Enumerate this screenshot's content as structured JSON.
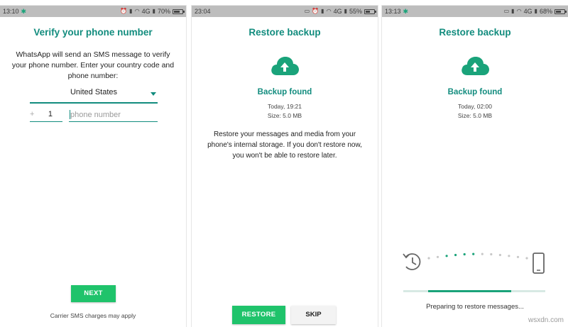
{
  "colors": {
    "accent": "#128c7e",
    "button_green": "#1fc36b",
    "statusbar": "#bdbdbd",
    "progress": "#1aa37a"
  },
  "screens": [
    {
      "statusbar": {
        "time": "13:10",
        "network": "4G",
        "battery": "70%",
        "battery_level": 0.7
      },
      "title": "Verify your phone number",
      "description": "WhatsApp will send an SMS message to verify your phone number. Enter your country code and phone number:",
      "country_select": {
        "value": "United States",
        "icon": "chevron-down-icon"
      },
      "country_code": {
        "prefix": "+",
        "value": "1"
      },
      "phone_input": {
        "placeholder": "phone number",
        "value": ""
      },
      "next_button": "NEXT",
      "carrier_note": "Carrier SMS charges may apply"
    },
    {
      "statusbar": {
        "time": "23:04",
        "network": "4G",
        "battery": "55%",
        "battery_level": 0.55
      },
      "title": "Restore backup",
      "cloud_icon": "cloud-upload-icon",
      "backup_found": "Backup found",
      "backup_date": "Today, 19:21",
      "backup_size": "Size: 5.0 MB",
      "description": "Restore your messages and media from your phone's internal storage. If you don't restore now, you won't be able to restore later.",
      "restore_button": "RESTORE",
      "skip_button": "SKIP"
    },
    {
      "statusbar": {
        "time": "13:13",
        "network": "4G",
        "battery": "68%",
        "battery_level": 0.68
      },
      "title": "Restore backup",
      "cloud_icon": "cloud-upload-icon",
      "backup_found": "Backup found",
      "backup_date": "Today, 02:00",
      "backup_size": "Size: 5.0 MB",
      "progress_icons": {
        "left": "history-icon",
        "right": "smartphone-icon"
      },
      "progress_fraction": 0.45,
      "status_text": "Preparing to restore messages..."
    }
  ],
  "watermark": "wsxdn.com"
}
